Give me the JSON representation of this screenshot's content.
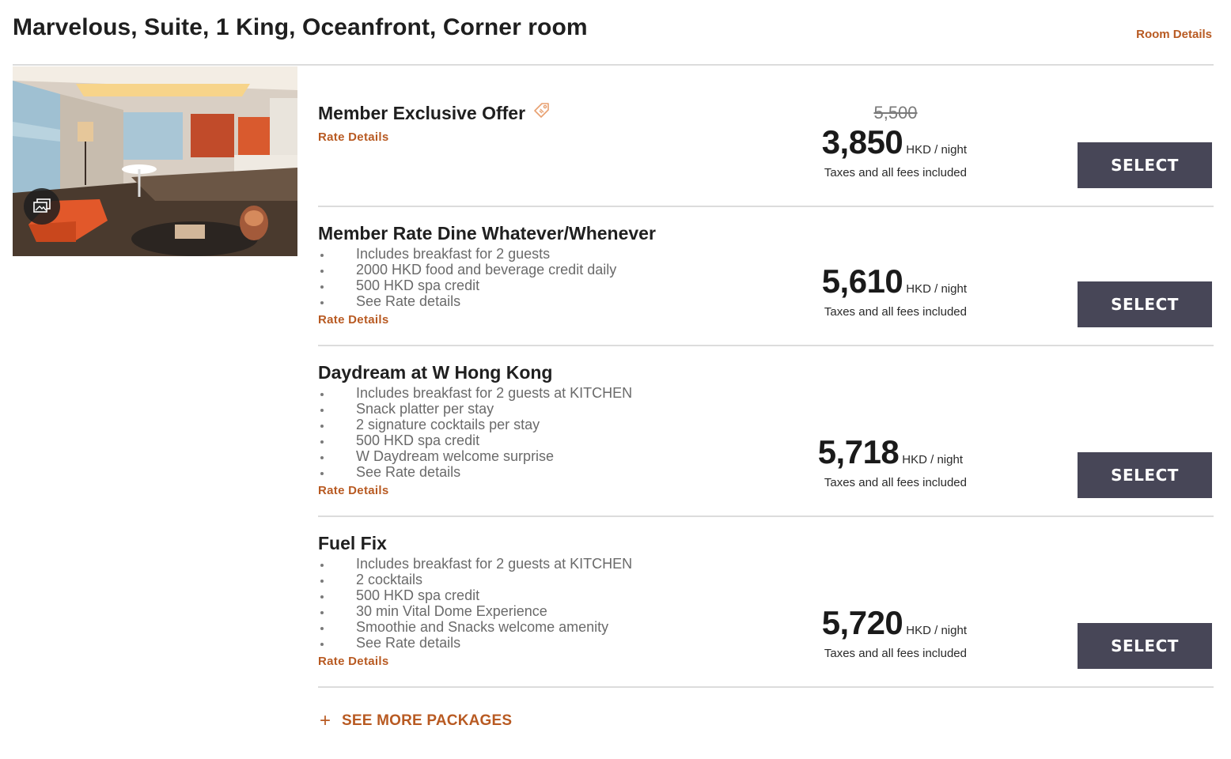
{
  "room": {
    "title": "Marvelous, Suite, 1 King, Oceanfront, Corner room",
    "details_link": "Room Details"
  },
  "icons": {
    "gallery": "photo-gallery-icon",
    "offer_tag": "tag-icon",
    "plus": "plus-icon"
  },
  "colors": {
    "accent": "#b85a22",
    "button_bg": "#474657",
    "divider": "#dcdcdc"
  },
  "rates": [
    {
      "name": "Member Exclusive Offer",
      "has_tag": true,
      "features": [],
      "details_label": "Rate Details",
      "original_price": "5,500",
      "price": "3,850",
      "unit": "HKD / night",
      "taxes": "Taxes and all fees included",
      "button": "SELECT"
    },
    {
      "name": "Member Rate Dine Whatever/Whenever",
      "features": [
        "Includes breakfast for 2 guests",
        "2000 HKD food and beverage credit daily",
        "500 HKD spa credit",
        "See Rate details"
      ],
      "details_label": "Rate Details",
      "price": "5,610",
      "unit": "HKD / night",
      "taxes": "Taxes and all fees included",
      "button": "SELECT"
    },
    {
      "name": "Daydream at W Hong Kong",
      "features": [
        "Includes breakfast for 2 guests at KITCHEN",
        "Snack platter per stay",
        "2 signature cocktails per stay",
        "500 HKD spa credit",
        "W Daydream welcome surprise",
        "See Rate details"
      ],
      "details_label": "Rate Details",
      "price": "5,718",
      "unit": "HKD / night",
      "taxes": "Taxes and all fees included",
      "button": "SELECT"
    },
    {
      "name": "Fuel Fix",
      "features": [
        "Includes breakfast for 2 guests at KITCHEN",
        "2 cocktails",
        "500 HKD spa credit",
        "30 min Vital Dome Experience",
        "Smoothie and Snacks welcome amenity",
        "See Rate details"
      ],
      "details_label": "Rate Details",
      "price": "5,720",
      "unit": "HKD / night",
      "taxes": "Taxes and all fees included",
      "button": "SELECT"
    }
  ],
  "see_more": {
    "symbol": "+",
    "label": "SEE MORE PACKAGES"
  }
}
